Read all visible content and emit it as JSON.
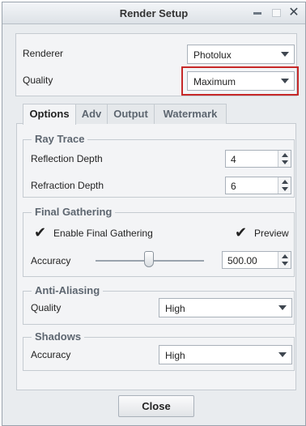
{
  "window": {
    "title": "Render Setup"
  },
  "top_panel": {
    "renderer_label": "Renderer",
    "renderer_value": "Photolux",
    "quality_label": "Quality",
    "quality_value": "Maximum"
  },
  "tabs": [
    {
      "label": "Options",
      "active": true
    },
    {
      "label": "Adv",
      "active": false
    },
    {
      "label": "Output",
      "active": false
    },
    {
      "label": "Watermark",
      "active": false
    }
  ],
  "ray_trace": {
    "title": "Ray Trace",
    "reflection_label": "Reflection Depth",
    "reflection_value": "4",
    "refraction_label": "Refraction Depth",
    "refraction_value": "6"
  },
  "final_gathering": {
    "title": "Final Gathering",
    "enable_label": "Enable Final Gathering",
    "enable_checked": true,
    "preview_label": "Preview",
    "preview_checked": true,
    "accuracy_label": "Accuracy",
    "accuracy_value": "500.00"
  },
  "anti_aliasing": {
    "title": "Anti-Aliasing",
    "quality_label": "Quality",
    "quality_value": "High"
  },
  "shadows": {
    "title": "Shadows",
    "accuracy_label": "Accuracy",
    "accuracy_value": "High"
  },
  "footer": {
    "close_label": "Close"
  }
}
